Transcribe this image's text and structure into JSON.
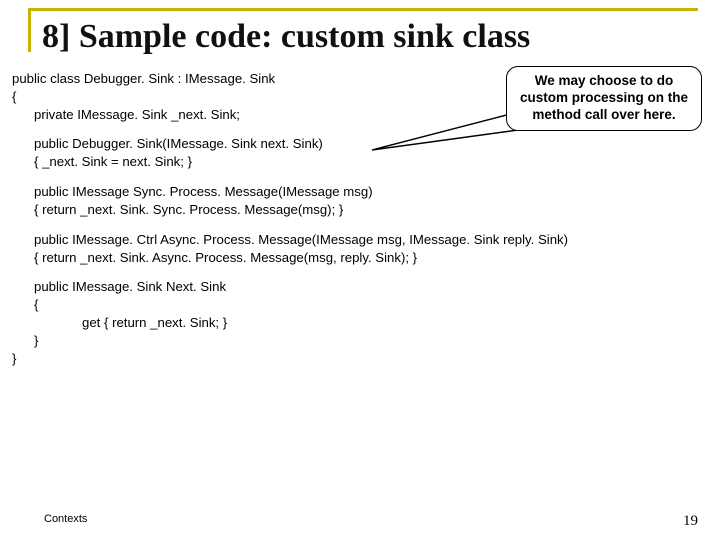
{
  "title": "8] Sample code: custom sink class",
  "code": {
    "l1": "public class Debugger. Sink : IMessage. Sink",
    "l2": "{",
    "l3": "private IMessage. Sink _next. Sink;",
    "l4": "public Debugger. Sink(IMessage. Sink next. Sink)",
    "l5": "{        _next. Sink = next. Sink;             }",
    "l6": "public IMessage Sync. Process. Message(IMessage msg)",
    "l7": "{         return _next. Sink. Sync. Process. Message(msg);   }",
    "l8": "public IMessage. Ctrl Async. Process. Message(IMessage msg, IMessage. Sink reply. Sink)",
    "l9": "{         return _next. Sink. Async. Process. Message(msg, reply. Sink);                           }",
    "l10": "public IMessage. Sink Next. Sink",
    "l11": "{",
    "l12": "get  {       return _next. Sink;       }",
    "l13": "}",
    "l14": "}"
  },
  "callout": "We may choose to do custom processing on the method call over here.",
  "footer": {
    "left": "Contexts",
    "right": "19"
  }
}
